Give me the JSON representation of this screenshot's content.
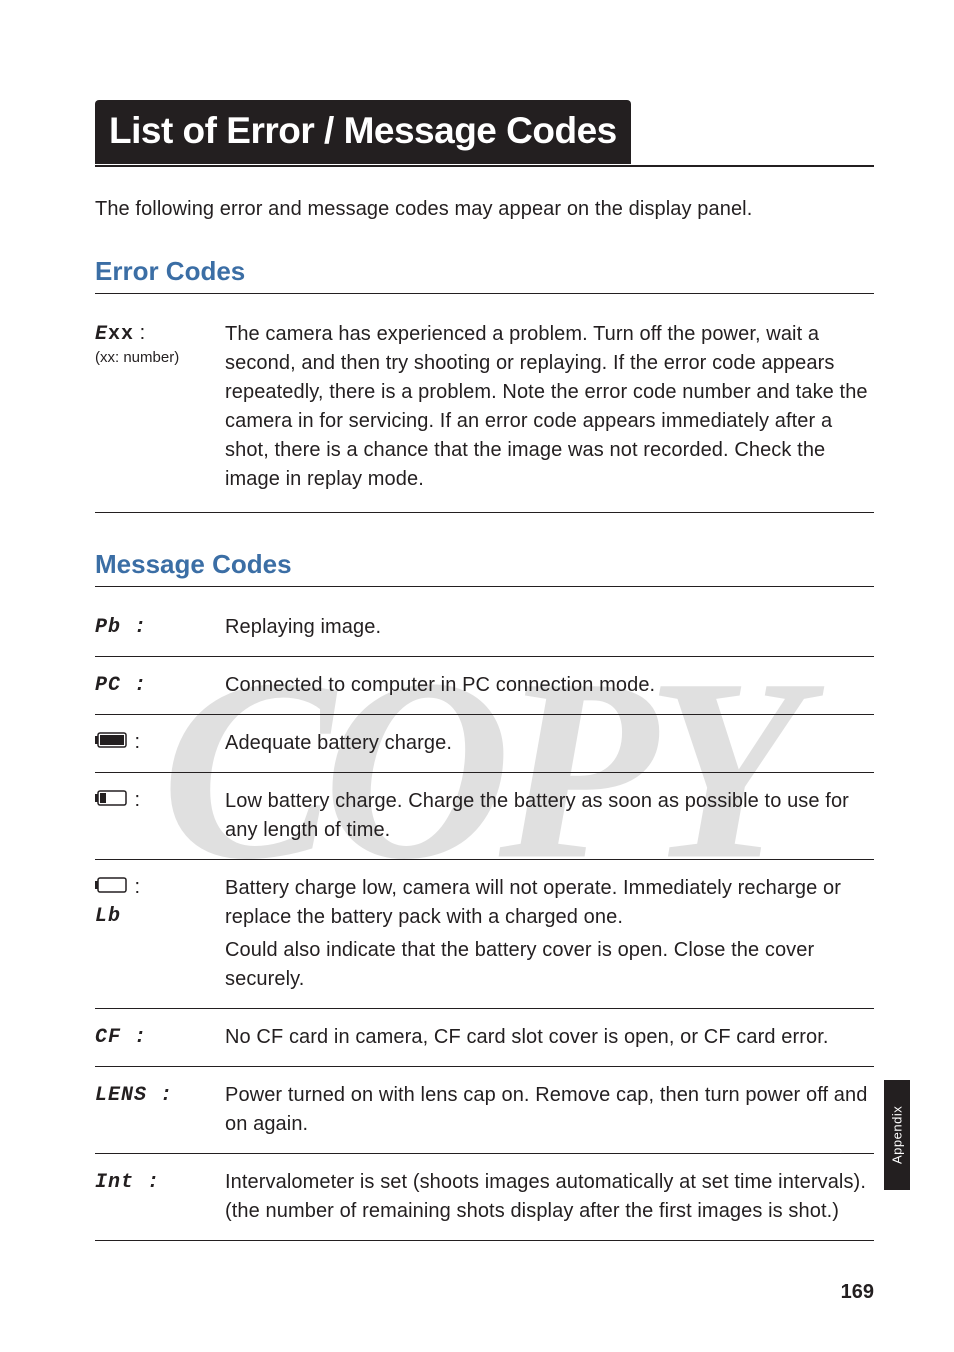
{
  "title": "List of Error / Message Codes",
  "intro": "The following error and message codes may appear on the display panel.",
  "sections": {
    "error": {
      "heading": "Error Codes",
      "rows": [
        {
          "code_html": "Exx :",
          "code_sub": "(xx: number)",
          "desc": "The camera has experienced a problem. Turn off the power, wait a second, and then try shooting or replaying. If the error code appears repeatedly, there is a problem. Note the error code number and take the camera in for servicing. If an error code appears immediately after a shot, there is a chance that the image was not recorded. Check the image in replay mode."
        }
      ]
    },
    "message": {
      "heading": "Message Codes",
      "rows": [
        {
          "icon": "seg",
          "code": "Pb :",
          "desc": "Replaying image."
        },
        {
          "icon": "seg",
          "code": "PC :",
          "desc": "Connected to computer in PC connection mode."
        },
        {
          "icon": "batt_full",
          "code": " :",
          "desc": "Adequate battery charge."
        },
        {
          "icon": "batt_low",
          "code": " :",
          "desc": "Low battery charge. Charge the battery as soon as possible to use for any length of time."
        },
        {
          "icon": "batt_empty_lb",
          "code": " :",
          "code2": "Lb",
          "desc": "Battery charge low, camera will not operate. Immediately recharge or replace the battery pack with a charged one.",
          "desc2": "Could also indicate that the battery cover is open. Close the cover securely."
        },
        {
          "icon": "seg",
          "code": "CF :",
          "desc": "No CF card in camera, CF card slot cover is open, or CF card error."
        },
        {
          "icon": "seg",
          "code": "LENS :",
          "desc": "Power turned on with lens cap on. Remove cap, then turn power off and on again."
        },
        {
          "icon": "seg",
          "code": "Int :",
          "desc": "Intervalometer is set (shoots images automatically at set time intervals). (the number of remaining shots display after the first images is shot.)"
        }
      ]
    }
  },
  "side_tab": "Appendix",
  "page_number": "169",
  "watermark": "COPY"
}
